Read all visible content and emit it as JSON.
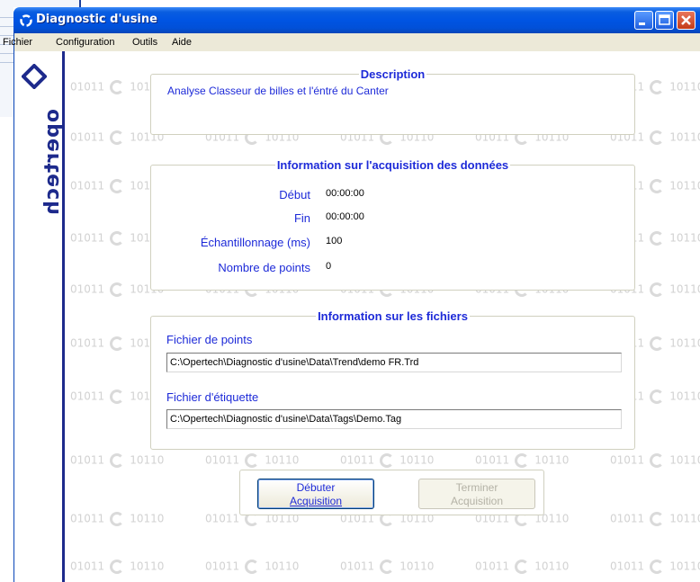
{
  "window": {
    "title": "Diagnostic d'usine"
  },
  "menu": [
    "Fichier",
    "Configuration",
    "Outils",
    "Aide"
  ],
  "logo": {
    "text": "opertech"
  },
  "watermark": {
    "left": "01011",
    "right": "10110"
  },
  "description": {
    "title": "Description",
    "text": "Analyse Classeur de billes et l'éntré du Canter"
  },
  "acquisition": {
    "title": "Information sur l'acquisition des données",
    "rows": [
      {
        "label": "Début",
        "value": "00:00:00"
      },
      {
        "label": "Fin",
        "value": "00:00:00"
      },
      {
        "label": "Échantillonnage (ms)",
        "value": "100"
      },
      {
        "label": "Nombre de points",
        "value": "0"
      }
    ]
  },
  "files": {
    "title": "Information sur les fichiers",
    "points_label": "Fichier de points",
    "points_path": "C:\\Opertech\\Diagnostic d'usine\\Data\\Trend\\demo FR.Trd",
    "tags_label": "Fichier d'étiquette",
    "tags_path": "C:\\Opertech\\Diagnostic d'usine\\Data\\Tags\\Demo.Tag"
  },
  "buttons": {
    "start_line1": "Débuter",
    "start_line2": "Acquisition",
    "stop_line1": "Terminer",
    "stop_line2": "Acquisition"
  },
  "colors": {
    "titlebar": "#0054e3",
    "label_blue": "#1d2ad8",
    "logo": "#1d2a8c"
  }
}
